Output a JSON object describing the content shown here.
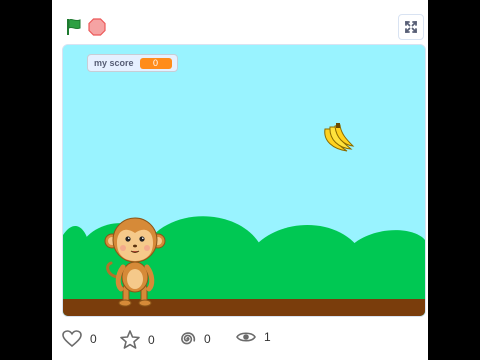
{
  "controls": {
    "green_flag_icon": "green-flag-icon",
    "stop_icon": "stop-sign-icon",
    "fullscreen_icon": "fullscreen-icon"
  },
  "monitor": {
    "label": "my score",
    "value": "0"
  },
  "stats": {
    "loves": "0",
    "favorites": "0",
    "remixes": "0",
    "views": "1"
  },
  "colors": {
    "sky": "#99f3ff",
    "hills": "#00c853",
    "ground": "#7a3d0c",
    "monitor_value_bg": "#ff8c1a",
    "flag_green": "#2ea043",
    "stop_red": "#ec5959"
  }
}
